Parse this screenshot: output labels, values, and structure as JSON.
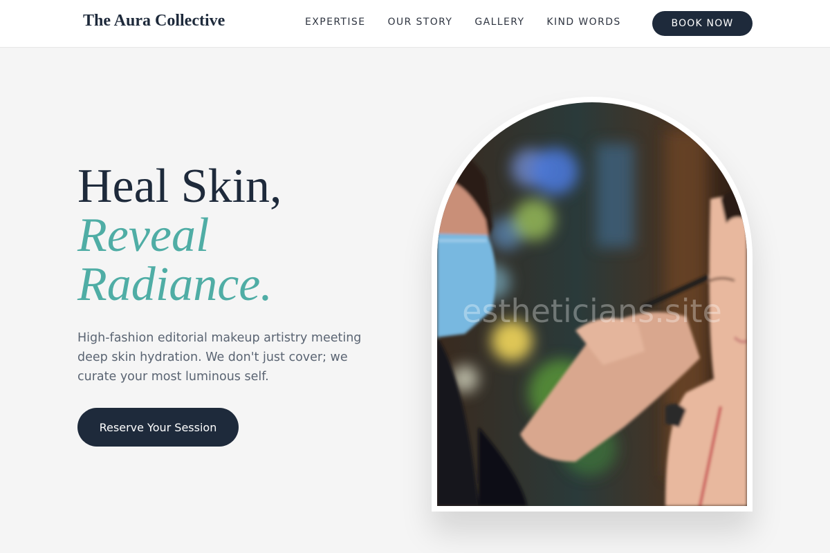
{
  "brand": {
    "name": "The Aura Collective"
  },
  "nav": {
    "links": [
      "EXPERTISE",
      "OUR STORY",
      "GALLERY",
      "KIND WORDS"
    ],
    "cta_label": "BOOK NOW"
  },
  "hero": {
    "title_line1": "Heal Skin,",
    "title_accent_line1": "Reveal",
    "title_accent_line2": "Radiance.",
    "description": "High-fashion editorial makeup artistry meeting deep skin hydration. We don't just cover; we curate your most luminous self.",
    "cta_label": "Reserve Your Session"
  },
  "image": {
    "watermark": "estheticians.site",
    "subject": "makeup-artist-applying-eyeliner-photo"
  },
  "colors": {
    "navy": "#1e2a3b",
    "teal": "#4fada5",
    "background": "#f5f5f5",
    "body_text": "#5a6472"
  }
}
